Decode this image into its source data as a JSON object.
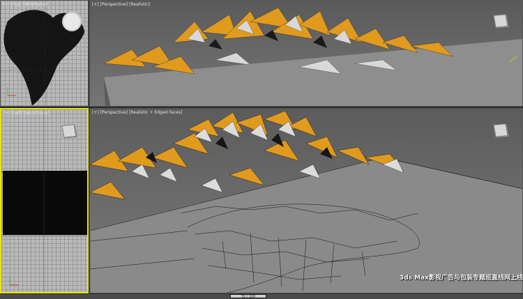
{
  "viewports": {
    "top": {
      "label_parts": [
        "[+]",
        "[Top]",
        "[Wireframe]"
      ]
    },
    "persp_top": {
      "label_parts": [
        "[+]",
        "[Perspective]",
        "[Realistic]"
      ]
    },
    "left": {
      "label_parts": [
        "[+]",
        "[Left]",
        "[Wireframe]"
      ]
    },
    "persp_main": {
      "label_parts": [
        "[+]",
        "[Perspective]",
        "[Realistic + Edged Faces]"
      ]
    }
  },
  "status": {
    "frame_counter": "72 / 100"
  },
  "watermark": {
    "text": "3ds Max影视广告与包装专题班直线网上线"
  },
  "colors": {
    "accent": "#e09a1e",
    "active_viewport_border": "#e6e600",
    "ground": "#8c8c8c",
    "wire": "#111111"
  },
  "icons": [
    "view-cube-icon",
    "axis-tripod-icon"
  ]
}
